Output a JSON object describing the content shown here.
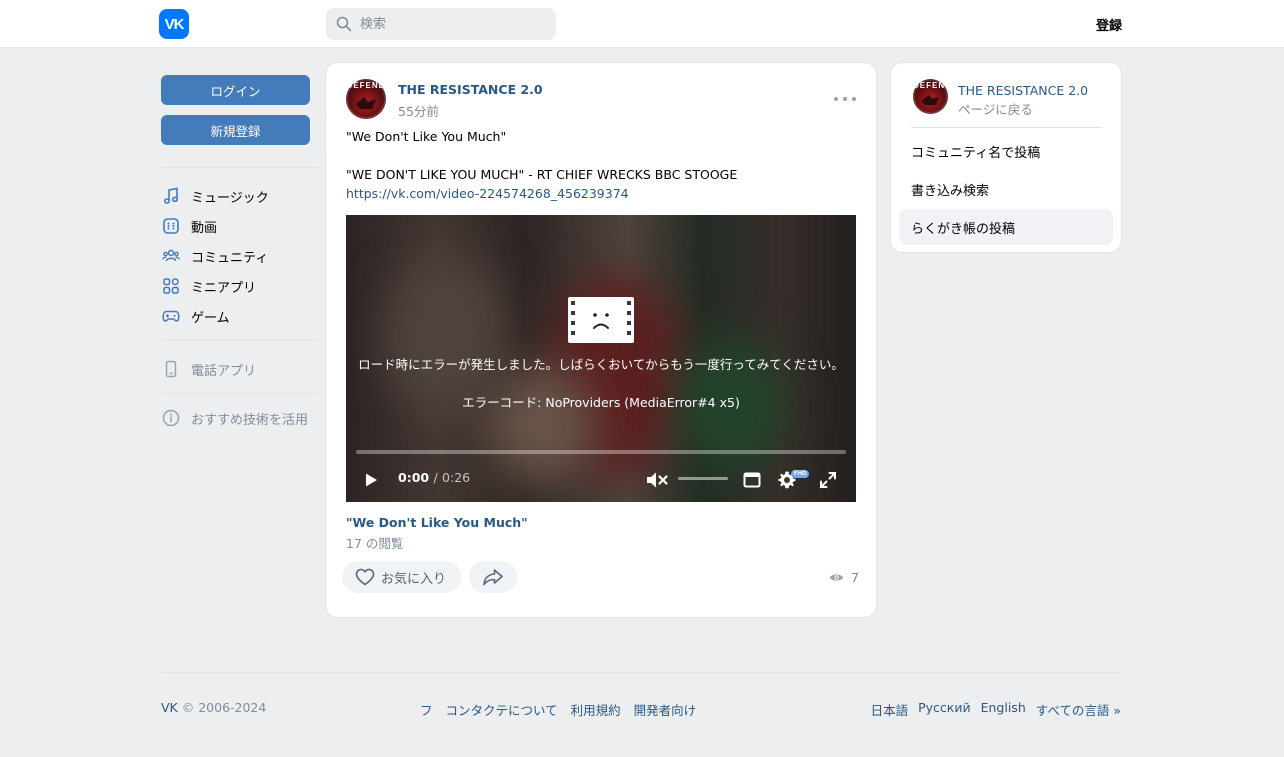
{
  "header": {
    "logo_text": "VK",
    "search_placeholder": "検索",
    "register_label": "登録"
  },
  "sidebar": {
    "login_label": "ログイン",
    "signup_label": "新規登録",
    "nav": [
      {
        "label": "ミュージック",
        "icon": "music-icon"
      },
      {
        "label": "動画",
        "icon": "video-icon"
      },
      {
        "label": "コミュニティ",
        "icon": "community-icon"
      },
      {
        "label": "ミニアプリ",
        "icon": "mini-apps-icon"
      },
      {
        "label": "ゲーム",
        "icon": "gamepad-icon"
      }
    ],
    "phone_app_label": "電話アプリ",
    "tech_label": "おすすめ技術を活用"
  },
  "post": {
    "author": "THE RESISTANCE 2.0",
    "avatar_text": "DEFEND",
    "time": "55分前",
    "text_line1": "\"We Don't Like You Much\"",
    "text_line2": "\"WE DON'T LIKE YOU MUCH\" - RT CHIEF WRECKS BBC STOOGE",
    "link": "https://vk.com/video-224574268_456239374",
    "video": {
      "error_message": "ロード時にエラーが発生しました。しばらくおいてからもう一度行ってみてください。",
      "error_code": "エラーコード: NoProviders (MediaError#4 x5)",
      "time_current": "0:00",
      "time_separator": "/",
      "time_total": "0:26",
      "quality_badge": "FHD",
      "progress": 0
    },
    "video_title": "\"We Don't Like You Much\"",
    "video_views": "17 の閲覧",
    "like_label": "お気に入り",
    "view_count": "7"
  },
  "side": {
    "author": "THE RESISTANCE 2.0",
    "back_label": "ページに戻る",
    "items": [
      {
        "label": "コミュニティ名で投稿"
      },
      {
        "label": "書き込み検索"
      },
      {
        "label": "らくがき帳の投稿"
      }
    ]
  },
  "footer": {
    "brand": "VK",
    "copyright": "© 2006-2024",
    "links": [
      "フ",
      "コンタクテについて",
      "利用規約",
      "開発者向け"
    ],
    "languages": [
      "日本語",
      "Русский",
      "English",
      "すべての言語 »"
    ]
  },
  "colors": {
    "accent": "#0077ff",
    "button": "#447bba",
    "link": "#2a5885",
    "muted": "#818c99",
    "background": "#edeef0"
  }
}
